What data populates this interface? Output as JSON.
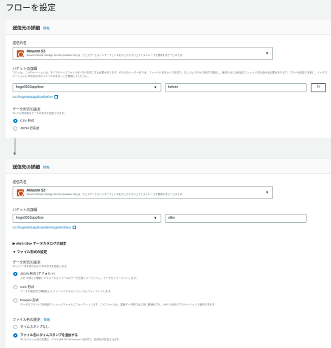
{
  "page": {
    "title": "フローを設定"
  },
  "source": {
    "header": "送信元の詳細",
    "info_link": "情報",
    "source_name_label": "送信元名",
    "service": {
      "name": "Amazon S3",
      "description": "Amazon Simple Storage Service (Amazon S3) は、ウェブサービスインターフェイスを介してオブジェクトストレージを提供するサービスです。"
    },
    "bucket_label": "バケットの詳細",
    "bucket_desc": "フローは、このロケーションは、すべてのソースファイルを CSV 形式にする必要があります。それらのヘッダー行では、フィールド名をカンマ区切り、もしくは JSON 行形式で指定し、最初の行には完全なフィールド名を含める必要があります。フローを設定する前に、ソースロケーションに有効な形式のファイルがあることを確認してください。",
    "bucket_value": "hoge0503appflow",
    "prefix_value": "before",
    "path_link": "s3://hoge0503appflow/before",
    "data_format_label": "データ形式の設定",
    "data_format_desc": "S3 から読み取るデータの形式を指定できます。",
    "formats": [
      {
        "label": "CSV 形式",
        "selected": true
      },
      {
        "label": "JSON 行形式",
        "selected": false
      }
    ]
  },
  "destination": {
    "header": "送信先の詳細",
    "info_link": "情報",
    "dest_name_label": "送信先名",
    "service": {
      "name": "Amazon S3",
      "description": "Amazon Simple Storage Service (Amazon S3) は、ウェブサービスインターフェイスを介してオブジェクトストレージを提供するサービスです。"
    },
    "bucket_label": "バケットの詳細",
    "bucket_value": "hoge0503appflow",
    "prefix_value": "after",
    "path_link": "s3://hoge0503appflow/after/hoge0503flow",
    "glue_section": "AWS Glue データカタログの設定",
    "file_format_section": "ファイル形式の設定",
    "data_format_label": "データ形式の設定",
    "data_format_desc": "S3 にデータを書き込むための形式を指定します。",
    "formats": [
      {
        "label": "JSON 形式 (デフォルト)",
        "desc": "人が が読んで理解しやすいテキストベースのデータ交換フォーマットに、データをフォーマットします。",
        "selected": true
      },
      {
        "label": "CSV 形式",
        "desc": "データを高形式で構造化したフレーンドテキストファイルにフォーマットします。",
        "selected": false
      },
      {
        "label": "Parquet 形式",
        "desc": "データをフラットな列指向ストレージファイルにフォーマットします。このファイルは、高速データ取り出し用に最適化され、AWS の分析アプリケーションで使用できます。",
        "selected": false
      }
    ],
    "filename_label": "ファイル名の設定",
    "filename_info": "情報",
    "filename_options": [
      {
        "label": "タイムスタンプなし",
        "selected": false
      },
      {
        "label": "ファイル名にタイムスタンプを追加する",
        "desc": "S3 のファイル名の先頭に、YYYY-MM-DDTHH:mm:ss の形式で、作成日が付加されます。",
        "selected": true
      }
    ]
  },
  "icons": {
    "refresh": "↻",
    "caret": "▼",
    "expand": "▶",
    "collapse": "▼"
  },
  "colors": {
    "accent": "#0073bb",
    "s3": "#c7511f"
  }
}
